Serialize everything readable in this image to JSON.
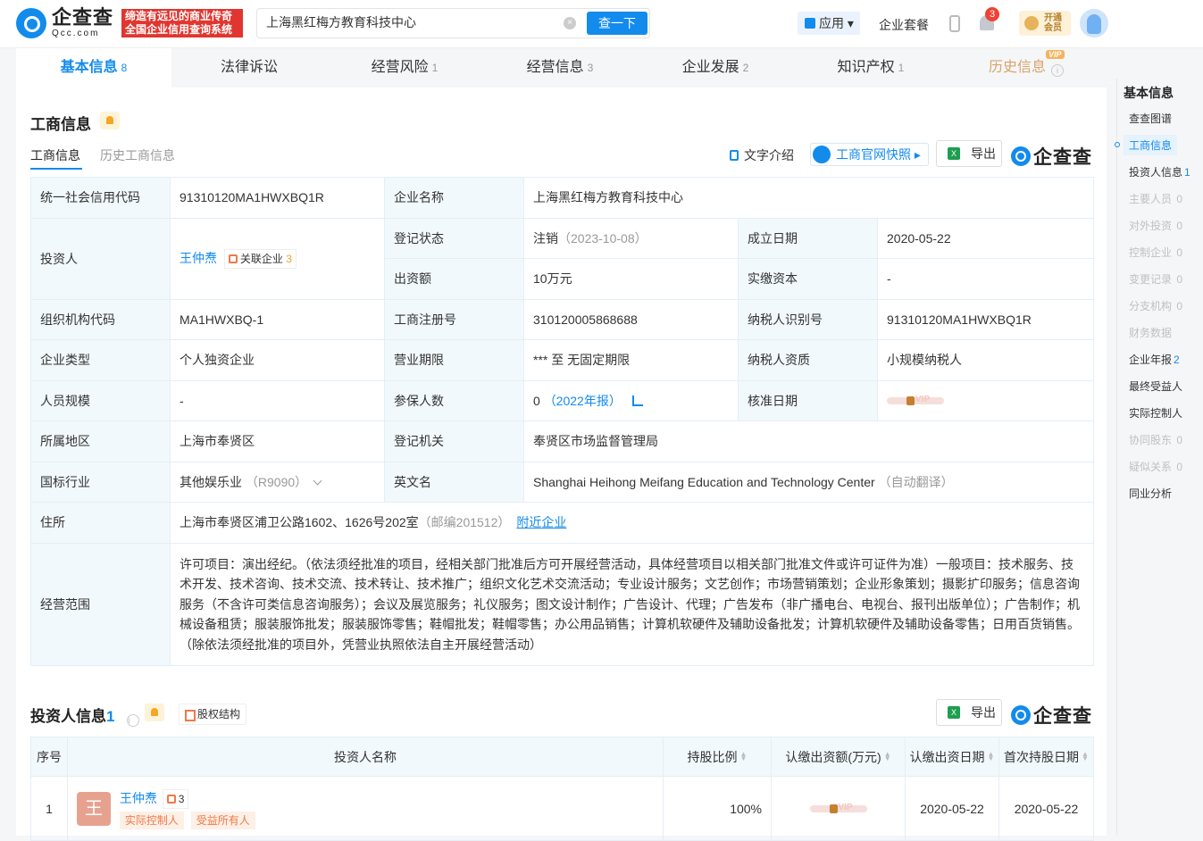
{
  "header": {
    "logo_cn": "企查查",
    "logo_en": "Qcc.com",
    "slogan_line1": "缔造有远见的商业传奇",
    "slogan_line2": "全国企业信用查询系统",
    "search_value": "上海黑红梅方教育科技中心",
    "search_button": "查一下",
    "app_label": "应用",
    "package_label": "企业套餐",
    "notification_count": "3",
    "vip_line1": "开通",
    "vip_line2": "会员"
  },
  "tabs": [
    {
      "label": "基本信息",
      "count": "8"
    },
    {
      "label": "法律诉讼",
      "count": ""
    },
    {
      "label": "经营风险",
      "count": "1"
    },
    {
      "label": "经营信息",
      "count": "3"
    },
    {
      "label": "企业发展",
      "count": "2"
    },
    {
      "label": "知识产权",
      "count": "1"
    },
    {
      "label": "历史信息",
      "count": "",
      "vip": "VIP"
    }
  ],
  "business": {
    "title": "工商信息",
    "subtab_active": "工商信息",
    "subtab_history": "历史工商信息",
    "text_intro": "文字介绍",
    "snapshot": "工商官网快照",
    "export": "导出",
    "brand": "企查查",
    "rows": {
      "credit_code_label": "统一社会信用代码",
      "credit_code": "91310120MA1HWXBQ1R",
      "company_name_label": "企业名称",
      "company_name": "上海黑红梅方教育科技中心",
      "investor_label": "投资人",
      "investor_name": "王仲焘",
      "investor_assoc": "关联企业",
      "investor_assoc_count": "3",
      "reg_status_label": "登记状态",
      "reg_status": "注销",
      "reg_status_date": "（2023-10-08）",
      "founded_label": "成立日期",
      "founded": "2020-05-22",
      "capital_label": "出资额",
      "capital": "10万元",
      "paid_capital_label": "实缴资本",
      "paid_capital": "-",
      "org_code_label": "组织机构代码",
      "org_code": "MA1HWXBQ-1",
      "reg_no_label": "工商注册号",
      "reg_no": "310120005868688",
      "taxpayer_id_label": "纳税人识别号",
      "taxpayer_id": "91310120MA1HWXBQ1R",
      "type_label": "企业类型",
      "type": "个人独资企业",
      "term_label": "营业期限",
      "term": "*** 至 无固定期限",
      "tax_qual_label": "纳税人资质",
      "tax_qual": "小规模纳税人",
      "staff_label": "人员规模",
      "staff": "-",
      "insured_label": "参保人数",
      "insured": "0",
      "insured_year": "（2022年报）",
      "approve_label": "核准日期",
      "approve_vip": "VIP",
      "region_label": "所属地区",
      "region": "上海市奉贤区",
      "authority_label": "登记机关",
      "authority": "奉贤区市场监督管理局",
      "industry_label": "国标行业",
      "industry": "其他娱乐业",
      "industry_code": "（R9090）",
      "english_label": "英文名",
      "english": "Shanghai Heihong Meifang Education and Technology Center",
      "english_note": "（自动翻译）",
      "address_label": "住所",
      "address": "上海市奉贤区浦卫公路1602、1626号202室",
      "address_zip": "（邮编201512）",
      "nearby": "附近企业",
      "scope_label": "经营范围",
      "scope": "许可项目：演出经纪。（依法须经批准的项目，经相关部门批准后方可开展经营活动，具体经营项目以相关部门批准文件或许可证件为准）一般项目：技术服务、技术开发、技术咨询、技术交流、技术转让、技术推广；组织文化艺术交流活动；专业设计服务；文艺创作；市场营销策划；企业形象策划；摄影扩印服务；信息咨询服务（不含许可类信息咨询服务）；会议及展览服务；礼仪服务；图文设计制作；广告设计、代理；广告发布（非广播电台、电视台、报刊出版单位）；广告制作；机械设备租赁；服装服饰批发；服装服饰零售；鞋帽批发；鞋帽零售；办公用品销售；计算机软硬件及辅助设备批发；计算机软硬件及辅助设备零售；日用百货销售。（除依法须经批准的项目外，凭营业执照依法自主开展经营活动）"
    }
  },
  "investors": {
    "title": "投资人信息",
    "count": "1",
    "equity_btn": "股权结构",
    "export": "导出",
    "brand": "企查查",
    "columns": [
      "序号",
      "投资人名称",
      "持股比例",
      "认缴出资额(万元)",
      "认缴出资日期",
      "首次持股日期"
    ],
    "rows": [
      {
        "index": "1",
        "avatar": "王",
        "name": "王仲焘",
        "assoc_count": "3",
        "tag1": "实际控制人",
        "tag2": "受益所有人",
        "ratio": "100%",
        "sub_vip": "VIP",
        "sub_date": "2020-05-22",
        "first_date": "2020-05-22"
      }
    ]
  },
  "sidebar": {
    "head": "基本信息",
    "items": [
      {
        "label": "查查图谱",
        "count": "",
        "state": "on"
      },
      {
        "label": "工商信息",
        "count": "",
        "state": "cur"
      },
      {
        "label": "投资人信息",
        "count": "1",
        "state": "on"
      },
      {
        "label": "主要人员",
        "count": "0",
        "state": "off"
      },
      {
        "label": "对外投资",
        "count": "0",
        "state": "off"
      },
      {
        "label": "控制企业",
        "count": "0",
        "state": "off"
      },
      {
        "label": "变更记录",
        "count": "0",
        "state": "off"
      },
      {
        "label": "分支机构",
        "count": "0",
        "state": "off"
      },
      {
        "label": "财务数据",
        "count": "",
        "state": "off"
      },
      {
        "label": "企业年报",
        "count": "2",
        "state": "on"
      },
      {
        "label": "最终受益人",
        "count": "",
        "state": "on"
      },
      {
        "label": "实际控制人",
        "count": "",
        "state": "on"
      },
      {
        "label": "协同股东",
        "count": "0",
        "state": "off"
      },
      {
        "label": "疑似关系",
        "count": "0",
        "state": "off"
      },
      {
        "label": "同业分析",
        "count": "",
        "state": "on"
      }
    ]
  }
}
